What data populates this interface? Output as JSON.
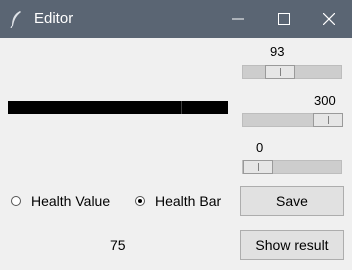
{
  "window": {
    "title": "Editor",
    "icons": {
      "app": "feather-icon",
      "minimize": "minimize-icon",
      "maximize": "maximize-icon",
      "close": "close-icon"
    }
  },
  "health_bar": {
    "value": 93,
    "max": 300
  },
  "scales": [
    {
      "name": "value-scale",
      "value": "93",
      "fraction": 0.31
    },
    {
      "name": "max-scale",
      "value": "300",
      "fraction": 1.0
    },
    {
      "name": "min-scale",
      "value": "0",
      "fraction": 0.0
    }
  ],
  "radios": [
    {
      "label": "Health Value",
      "selected": false
    },
    {
      "label": "Health Bar",
      "selected": true
    }
  ],
  "buttons": {
    "save": "Save",
    "show_result": "Show result"
  },
  "result_value": "75",
  "colors": {
    "titlebar": "#5a6573",
    "bar_fill": "#000000",
    "background": "#f0f0f0"
  }
}
